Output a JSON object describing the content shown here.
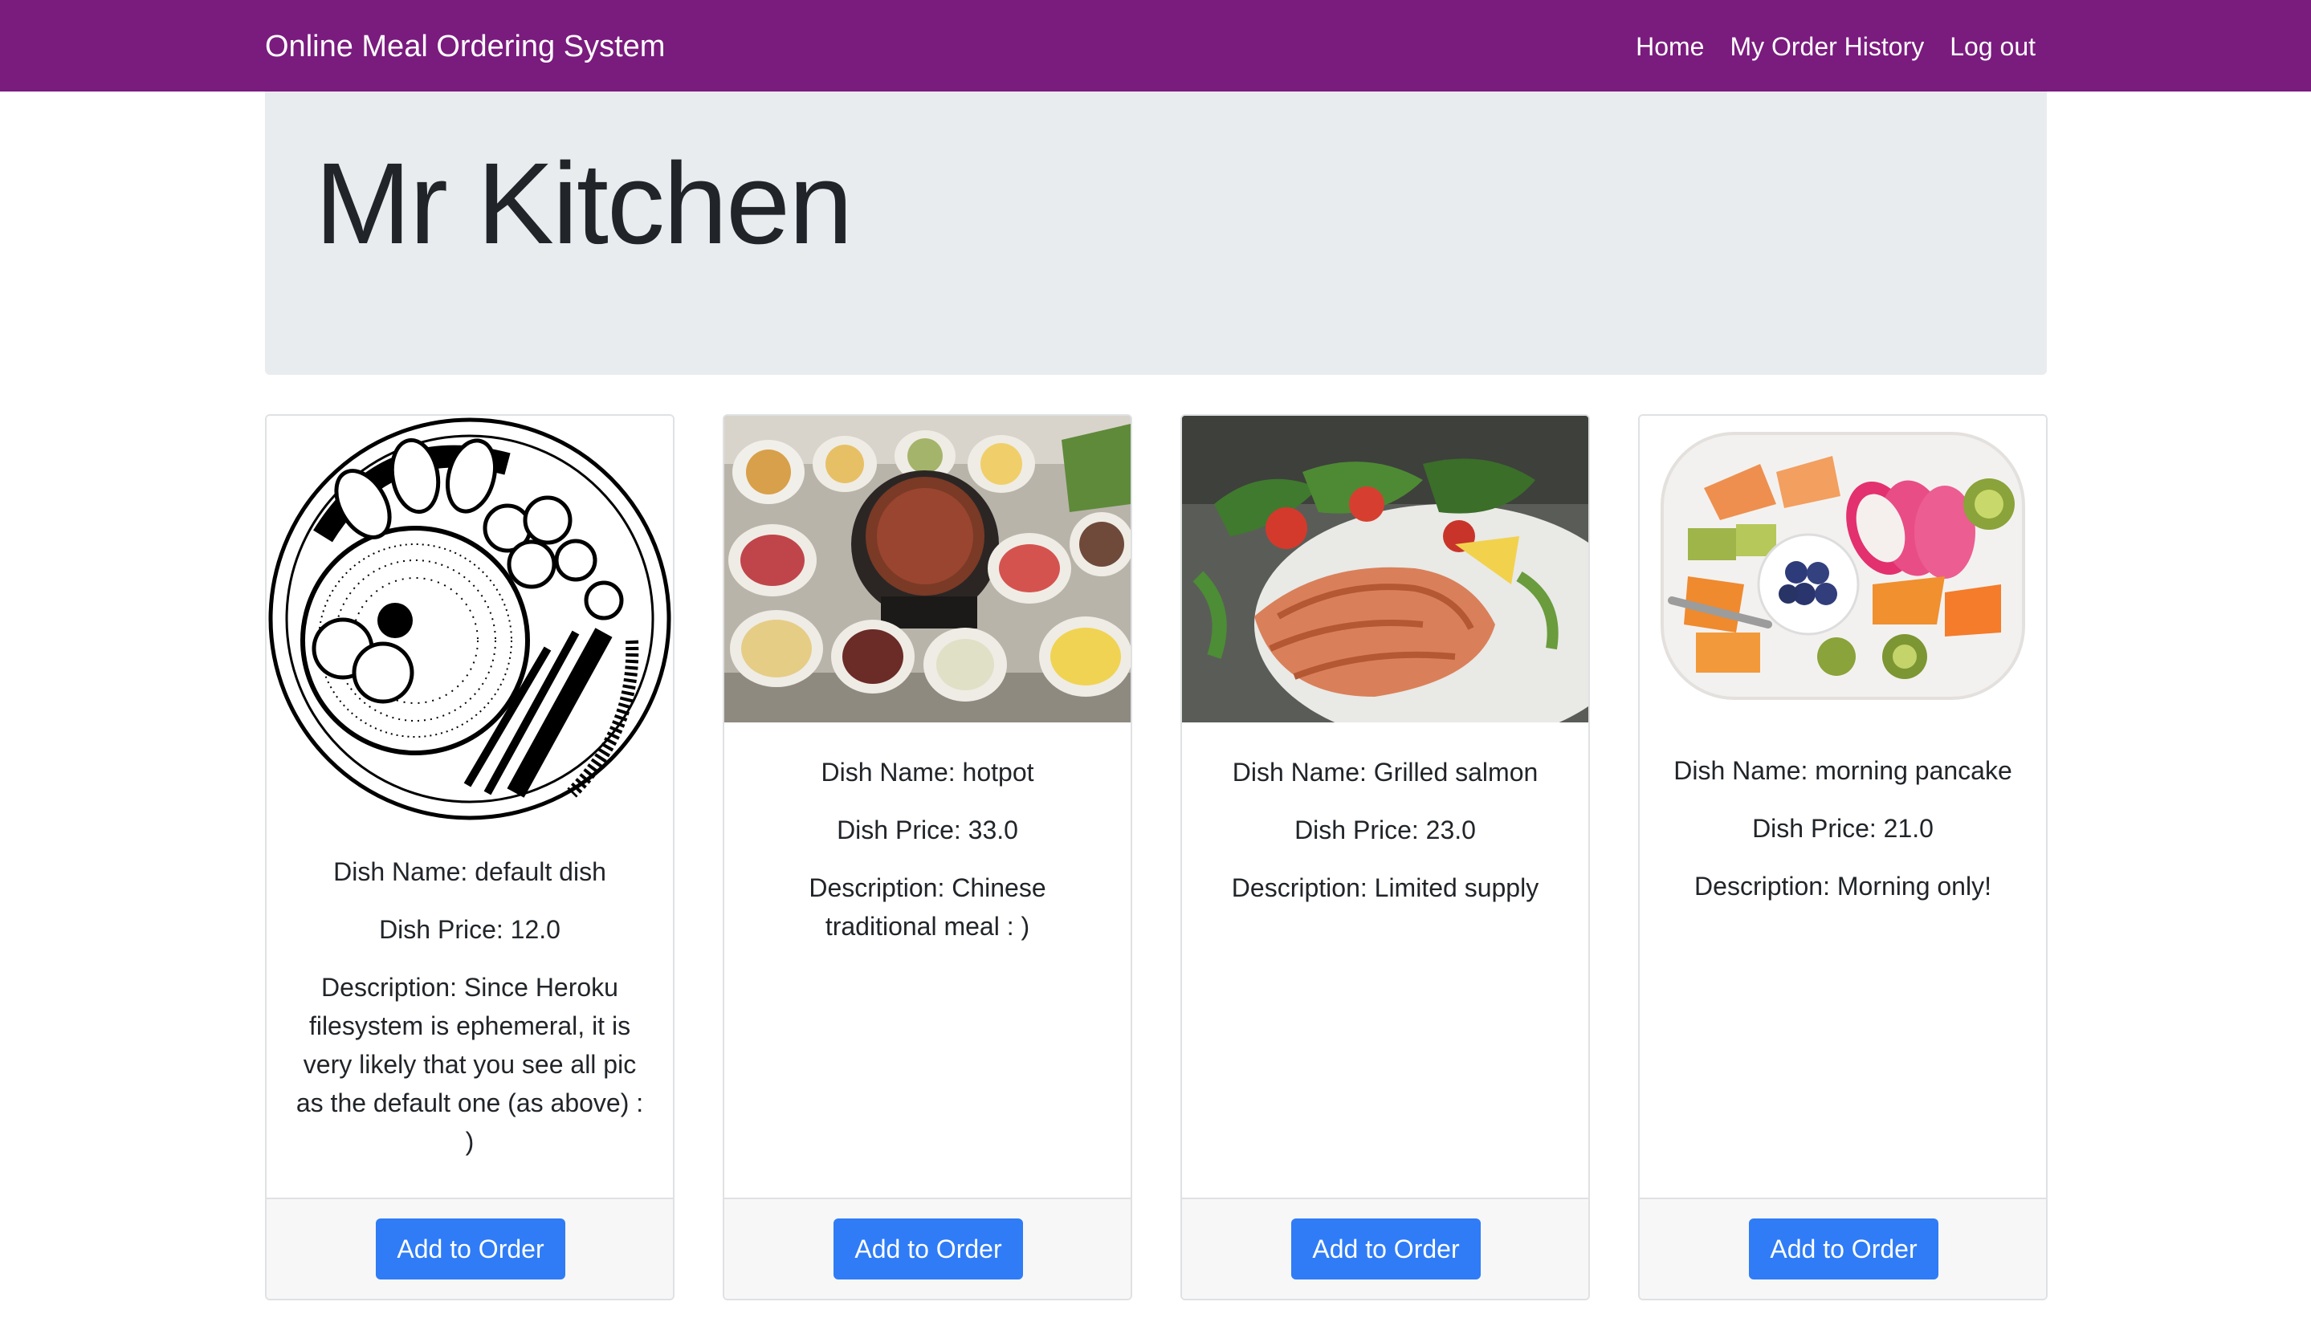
{
  "navbar": {
    "brand": "Online Meal Ordering System",
    "links": [
      "Home",
      "My Order History",
      "Log out"
    ]
  },
  "jumbotron": {
    "title": "Mr Kitchen"
  },
  "cards": [
    {
      "image": "plate-drawing",
      "dish_name": "Dish Name: default dish",
      "dish_price": "Dish Price: 12.0",
      "description": "Description: Since Heroku filesystem is ephemeral, it is very likely that you see all pic as the default one (as above) : )",
      "button": "Add to Order"
    },
    {
      "image": "hotpot-photo",
      "dish_name": "Dish Name: hotpot",
      "dish_price": "Dish Price: 33.0",
      "description": "Description: Chinese traditional meal : )",
      "button": "Add to Order"
    },
    {
      "image": "salmon-photo",
      "dish_name": "Dish Name: Grilled salmon",
      "dish_price": "Dish Price: 23.0",
      "description": "Description: Limited supply",
      "button": "Add to Order"
    },
    {
      "image": "fruit-platter-photo",
      "dish_name": "Dish Name: morning pancake",
      "dish_price": "Dish Price: 21.0",
      "description": "Description: Morning only!",
      "button": "Add to Order"
    }
  ],
  "colors": {
    "navbar": "#7a1b7e",
    "button": "#2f7cf6",
    "jumbotron": "#e9ecef"
  }
}
